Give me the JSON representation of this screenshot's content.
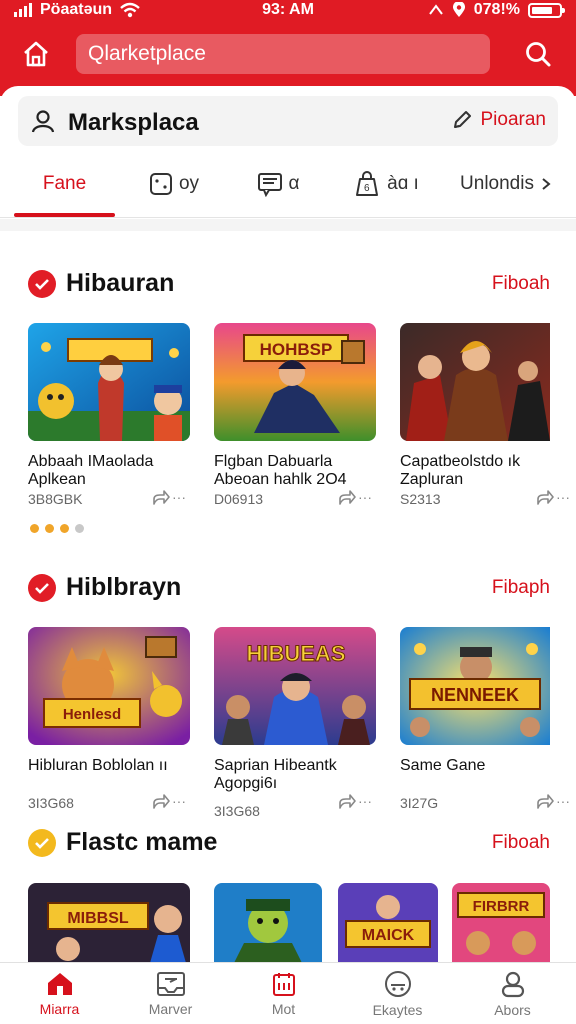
{
  "status_bar": {
    "carrier": "Pöaatəun",
    "time": "93: AM",
    "battery": "078!%",
    "battery_level": 0.78
  },
  "header": {
    "search_placeholder": "Qlarketplace"
  },
  "marketplace_bar": {
    "title": "Marksplaca",
    "action_label": "Pioaran"
  },
  "tabs": [
    {
      "label": "Fane",
      "icon": "none"
    },
    {
      "label": "oy",
      "icon": "dice-icon"
    },
    {
      "label": "α",
      "icon": "chat-icon"
    },
    {
      "label": "àɑ ı",
      "icon": "bag-icon"
    },
    {
      "label": "Unlondis",
      "icon": "chevron-right-icon"
    }
  ],
  "sections": [
    {
      "title": "Hibauran",
      "more_label": "Fiboah",
      "badge_color": "#e11d26",
      "cards": [
        {
          "name": "Abbaah IMaolada Aplkean",
          "meta": "3B8GBK"
        },
        {
          "name": "Flgban Dabuarla Abeoan hahlk 2O4",
          "meta": "D06913"
        },
        {
          "name": "Capatbeolstdo ık Zapluran",
          "meta": "S2313"
        }
      ]
    },
    {
      "title": "Hiblbrayn",
      "more_label": "Fibaph",
      "badge_color": "#e11d26",
      "cards": [
        {
          "name": "Hibluran Boblolan ıı",
          "meta": "3I3G68"
        },
        {
          "name": "Saprian Hibeantk Agopgi6ı",
          "meta": "3I3G68"
        },
        {
          "name": "Same Gane",
          "meta": "3I27G"
        }
      ]
    },
    {
      "title": "Flastc mame",
      "more_label": "Fiboah",
      "badge_color": "#f3b91e"
    }
  ],
  "thumb_texts": [
    "",
    "HOHBSP",
    "",
    "Henlesd",
    "HIBUEAS",
    "NENNEEK",
    "MIBBSL",
    "",
    "MAICK",
    "FIRBRR"
  ],
  "bottom_nav": [
    {
      "label": "Miarra",
      "icon": "home-icon"
    },
    {
      "label": "Marver",
      "icon": "inbox-icon"
    },
    {
      "label": "Mot",
      "icon": "orders-icon"
    },
    {
      "label": "Ekaytes",
      "icon": "game-controller-icon"
    },
    {
      "label": "Abors",
      "icon": "user-icon"
    }
  ]
}
